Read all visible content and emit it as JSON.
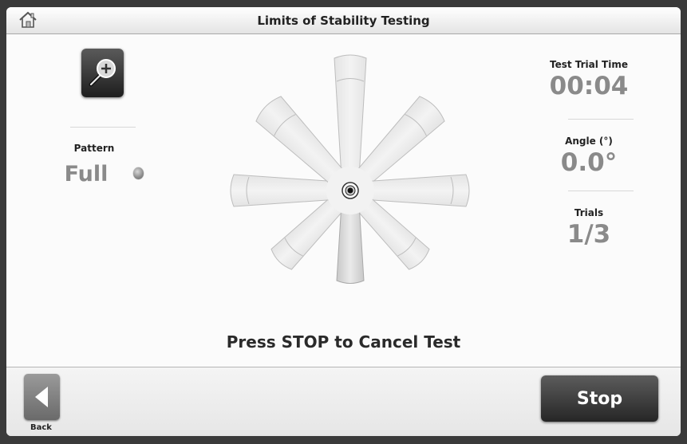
{
  "header": {
    "title": "Limits of Stability Testing",
    "home_icon": "home-icon"
  },
  "left_panel": {
    "zoom_icon": "zoom-in-icon",
    "pattern_label": "Pattern",
    "pattern_value": "Full",
    "pattern_indicator_color": "#8a8a8a"
  },
  "right_panel": {
    "trial_time_label": "Test Trial Time",
    "trial_time_value": "00:04",
    "angle_label": "Angle (°)",
    "angle_value": "0.0°",
    "trials_label": "Trials",
    "trials_value": "1/3"
  },
  "target_pattern": {
    "directions": 8,
    "highlighted_target": "S"
  },
  "instruction": "Press STOP to Cancel Test",
  "footer": {
    "back_label": "Back",
    "stop_label": "Stop"
  }
}
